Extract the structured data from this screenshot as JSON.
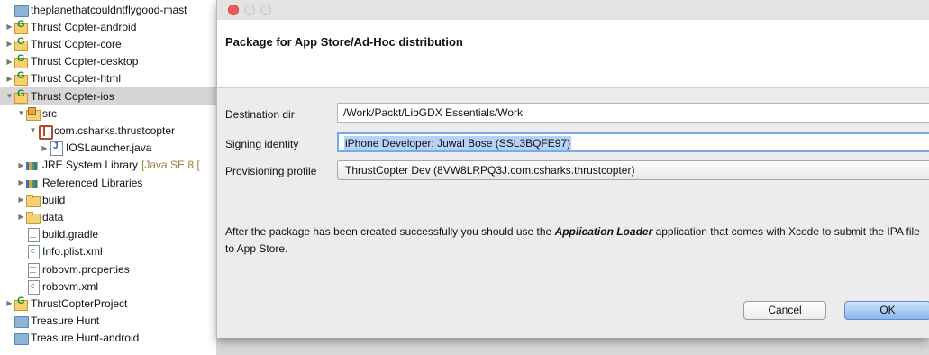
{
  "tree": {
    "items": [
      {
        "label": "theplanethatcouldntflygood-mast",
        "icon": "folder-blue-icon",
        "depth": 0,
        "twisty": "",
        "selected": false
      },
      {
        "label": "Thrust Copter-android",
        "icon": "gradle-project-icon",
        "depth": 0,
        "twisty": "▶",
        "selected": false
      },
      {
        "label": "Thrust Copter-core",
        "icon": "gradle-project-icon",
        "depth": 0,
        "twisty": "▶",
        "selected": false
      },
      {
        "label": "Thrust Copter-desktop",
        "icon": "gradle-project-icon",
        "depth": 0,
        "twisty": "▶",
        "selected": false
      },
      {
        "label": "Thrust Copter-html",
        "icon": "gradle-project-icon",
        "depth": 0,
        "twisty": "▶",
        "selected": false
      },
      {
        "label": "Thrust Copter-ios",
        "icon": "gradle-project-icon",
        "depth": 0,
        "twisty": "▼",
        "selected": true
      },
      {
        "label": "src",
        "icon": "source-folder-icon",
        "depth": 1,
        "twisty": "▼",
        "selected": false
      },
      {
        "label": "com.csharks.thrustcopter",
        "icon": "package-icon",
        "depth": 2,
        "twisty": "▼",
        "selected": false
      },
      {
        "label": "IOSLauncher.java",
        "icon": "java-file-icon",
        "depth": 3,
        "twisty": "▶",
        "selected": false
      },
      {
        "label": "JRE System Library",
        "decoration": "[Java SE 8 [",
        "icon": "library-icon",
        "depth": 1,
        "twisty": "▶",
        "selected": false
      },
      {
        "label": "Referenced Libraries",
        "icon": "library-icon",
        "depth": 1,
        "twisty": "▶",
        "selected": false
      },
      {
        "label": "build",
        "icon": "folder-icon",
        "depth": 1,
        "twisty": "▶",
        "selected": false
      },
      {
        "label": "data",
        "icon": "folder-icon",
        "depth": 1,
        "twisty": "▶",
        "selected": false
      },
      {
        "label": "build.gradle",
        "icon": "file-icon",
        "depth": 1,
        "twisty": "",
        "selected": false
      },
      {
        "label": "Info.plist.xml",
        "icon": "xml-file-icon",
        "depth": 1,
        "twisty": "",
        "selected": false
      },
      {
        "label": "robovm.properties",
        "icon": "file-icon",
        "depth": 1,
        "twisty": "",
        "selected": false
      },
      {
        "label": "robovm.xml",
        "icon": "xml-file-icon",
        "depth": 1,
        "twisty": "",
        "selected": false
      },
      {
        "label": "ThrustCopterProject",
        "icon": "gradle-project-icon",
        "depth": 0,
        "twisty": "▶",
        "selected": false
      },
      {
        "label": "Treasure Hunt",
        "icon": "folder-blue-icon",
        "depth": 0,
        "twisty": "",
        "selected": false
      },
      {
        "label": "Treasure Hunt-android",
        "icon": "folder-blue-icon",
        "depth": 0,
        "twisty": "",
        "selected": false
      }
    ]
  },
  "dialog": {
    "title": "Package for App Store/Ad-Hoc distribution",
    "destination_label": "Destination dir",
    "destination_value": "/Work/Packt/LibGDX Essentials/Work",
    "signing_label": "Signing identity",
    "signing_value": "iPhone Developer: Juwal Bose (SSL3BQFE97)",
    "provisioning_label": "Provisioning profile",
    "provisioning_value": "ThrustCopter Dev (8VW8LRPQ3J.com.csharks.thrustcopter)",
    "info_before": "After the package has been created successfully you should use the ",
    "info_emphasis": "Application Loader",
    "info_after": " application that comes with Xcode to submit the IPA file to App Store.",
    "cancel_label": "Cancel",
    "ok_label": "OK"
  },
  "colors": {
    "close_button": "#f25a57",
    "ok_button": "#89b8ee",
    "selection": "#b5d3f8"
  }
}
